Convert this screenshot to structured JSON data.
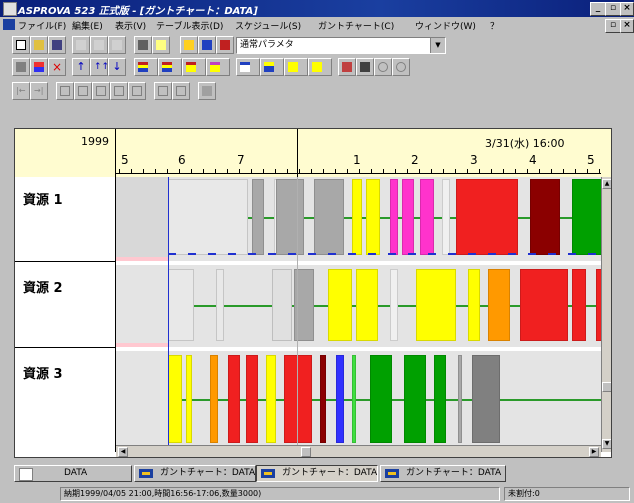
{
  "window": {
    "title": "ASPROVA 523 正式版 - [ガントチャート：DATA]"
  },
  "menu": [
    "ファイル(F)",
    "編集(E)",
    "表示(V)",
    "テーブル表示(D)",
    "スケジュール(S)",
    "ガントチャート(C)",
    "ウィンドウ(W)",
    "？"
  ],
  "toolbar": {
    "param_combo_value": "通常パラメタ"
  },
  "gantt": {
    "year_label": "1999",
    "date_label": "3/31(水) 16:00",
    "ticks": [
      "5",
      "6",
      "7",
      "1",
      "2",
      "3",
      "4",
      "5"
    ],
    "resources": [
      "資源 1",
      "資源 2",
      "資源 3"
    ],
    "colors": {
      "yellow": "#ffff00",
      "magenta": "#ff33cc",
      "red": "#f02020",
      "darkred": "#8b0000",
      "green": "#00a000",
      "gray": "#a8a8a8",
      "orange": "#ff9900",
      "blue": "#3030ff",
      "header": "#fffcd0"
    }
  },
  "tabs": [
    "DATA",
    "ガントチャート：DATA",
    "ガントチャート：DATA",
    "ガントチャート：DATA"
  ],
  "status": {
    "info": "納期1999/04/05 21:00,時間16:56-17:06,数量3000)",
    "unassigned": "未割付:0"
  }
}
